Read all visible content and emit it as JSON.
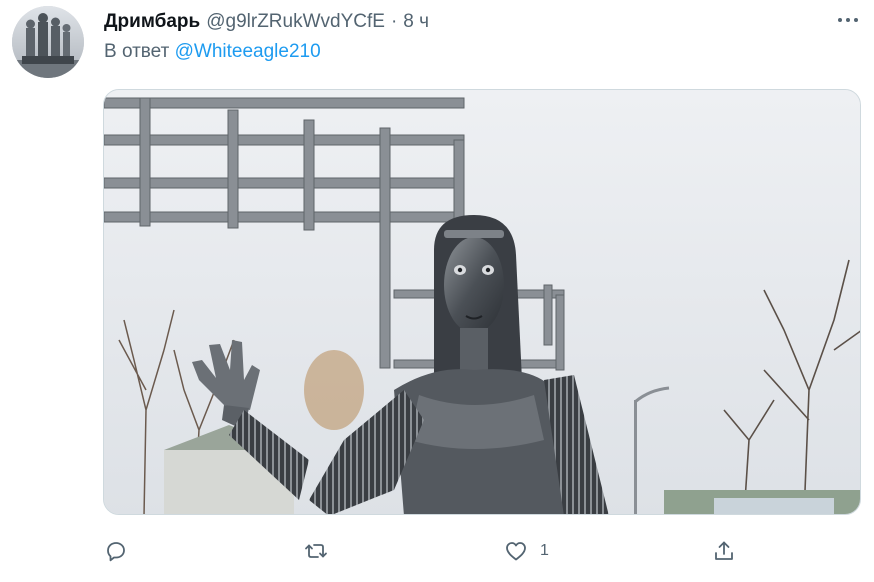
{
  "tweet": {
    "author": {
      "display_name": "Дримбарь",
      "handle": "@g9lrZRukWvdYCfE",
      "avatar_icon": "avatar-monument-photo"
    },
    "separator": "·",
    "timestamp": "8 ч",
    "reply_prefix": "В ответ",
    "reply_mention": "@Whiteeagle210",
    "media": {
      "kind": "photo",
      "subject": "metal statue in front of a lattice frame"
    },
    "actions": {
      "reply": {
        "icon": "reply-bubble-icon",
        "count": ""
      },
      "retweet": {
        "icon": "retweet-icon",
        "count": ""
      },
      "like": {
        "icon": "heart-icon",
        "count": "1"
      },
      "share": {
        "icon": "share-icon",
        "count": ""
      }
    }
  },
  "colors": {
    "text": "#0f1419",
    "secondary": "#536471",
    "link": "#1d9bf0",
    "border": "#cfd9de"
  }
}
